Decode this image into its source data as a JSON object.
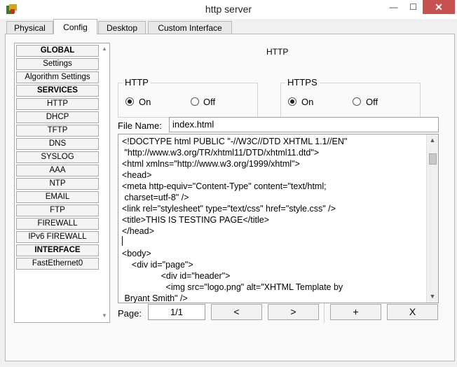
{
  "window": {
    "title": "http server"
  },
  "tabs": [
    "Physical",
    "Config",
    "Desktop",
    "Custom Interface"
  ],
  "sidebar": {
    "items": [
      "GLOBAL",
      "Settings",
      "Algorithm Settings",
      "SERVICES",
      "HTTP",
      "DHCP",
      "TFTP",
      "DNS",
      "SYSLOG",
      "AAA",
      "NTP",
      "EMAIL",
      "FTP",
      "FIREWALL",
      "IPv6 FIREWALL",
      "INTERFACE",
      "FastEthernet0"
    ]
  },
  "main": {
    "title": "HTTP",
    "http_group": {
      "label": "HTTP",
      "on": "On",
      "off": "Off",
      "selected": "On"
    },
    "https_group": {
      "label": "HTTPS",
      "on": "On",
      "off": "Off",
      "selected": "On"
    },
    "file_name_label": "File Name:",
    "file_name_value": "index.html",
    "code": "<!DOCTYPE html PUBLIC \"-//W3C//DTD XHTML 1.1//EN\"\n \"http://www.w3.org/TR/xhtml11/DTD/xhtml11.dtd\">\n<html xmlns=\"http://www.w3.org/1999/xhtml\">\n<head>\n<meta http-equiv=\"Content-Type\" content=\"text/html;\n charset=utf-8\" />\n<link rel=\"stylesheet\" type=\"text/css\" href=\"style.css\" />\n<title>THIS IS TESTING PAGE</title>\n</head>\n\n<body>\n    <div id=\"page\">\n                <div id=\"header\">\n                  <img src=\"logo.png\" alt=\"XHTML Template by\n Bryant Smith\" />",
    "page_label": "Page:",
    "page_value": "1/1",
    "buttons": {
      "prev": "<",
      "next": ">",
      "add": "+",
      "delete": "X"
    }
  }
}
